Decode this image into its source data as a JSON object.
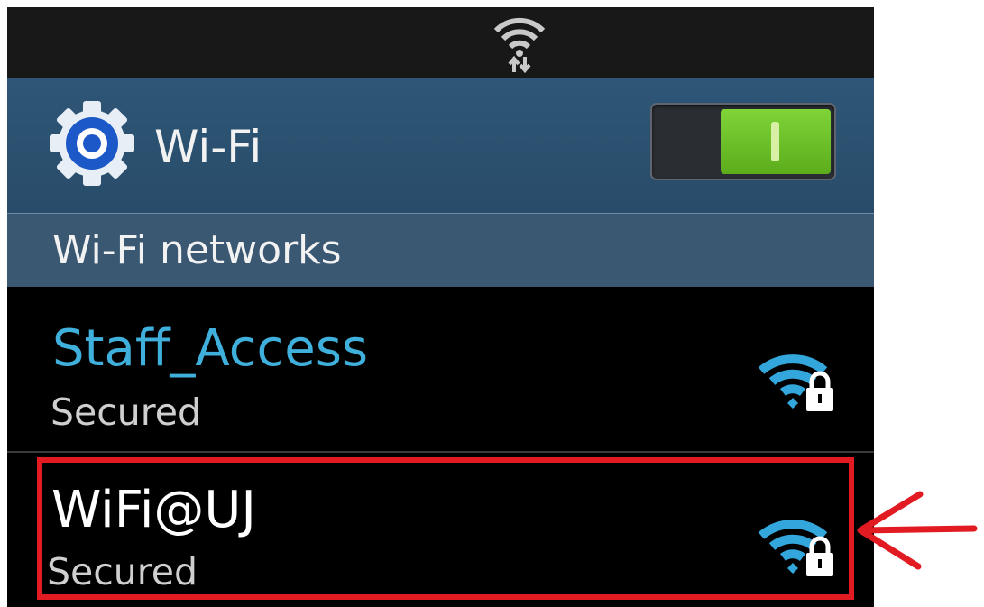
{
  "header": {
    "title": "Wi-Fi",
    "toggle_on": true
  },
  "section": {
    "title": "Wi-Fi networks"
  },
  "networks": [
    {
      "name": "Staff_Access",
      "status": "Secured"
    },
    {
      "name": "WiFi@UJ",
      "status": "Secured"
    }
  ],
  "icons": {
    "status": "wifi-data-icon",
    "settings": "gear-icon",
    "signal": "wifi-lock-icon",
    "annotation": "red-arrow-icon"
  },
  "colors": {
    "accent_blue": "#3fb0dc",
    "toggle_green": "#6cc02a",
    "header_blue": "#2f5677",
    "highlight_red": "#e21b23"
  }
}
